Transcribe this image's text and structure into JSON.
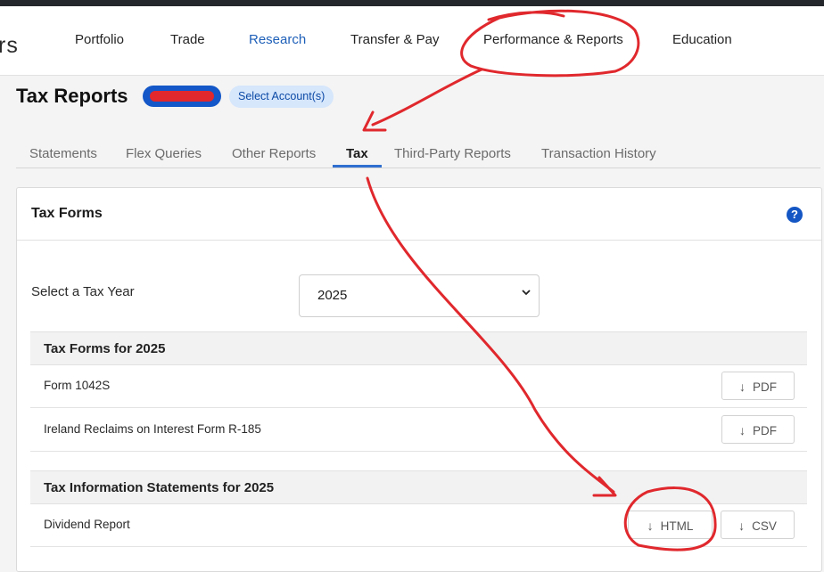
{
  "nav": {
    "brand_fragment": "rs",
    "items": [
      "Portfolio",
      "Trade",
      "Research",
      "Transfer & Pay",
      "Performance & Reports",
      "Education"
    ],
    "active": "Research"
  },
  "header": {
    "title": "Tax Reports",
    "select_account_label": "Select Account(s)"
  },
  "tabs": {
    "items": [
      "Statements",
      "Flex Queries",
      "Other Reports",
      "Tax",
      "Third-Party Reports",
      "Transaction History"
    ],
    "active": "Tax"
  },
  "card": {
    "title": "Tax Forms",
    "help_icon": "?",
    "year_label": "Select a Tax Year",
    "year_value": "2025",
    "year_chevron": "⌄"
  },
  "sections": [
    {
      "title": "Tax Forms for 2025",
      "rows": [
        {
          "label": "Form 1042S",
          "buttons": [
            "PDF"
          ]
        },
        {
          "label": "Ireland Reclaims on Interest Form R-185",
          "buttons": [
            "PDF"
          ]
        }
      ]
    },
    {
      "title": "Tax Information Statements for 2025",
      "rows": [
        {
          "label": "Dividend Report",
          "buttons": [
            "HTML",
            "CSV"
          ]
        }
      ]
    }
  ],
  "icons": {
    "download": "↓",
    "help": "question-circle-icon"
  },
  "colors": {
    "accent": "#1d5fb8",
    "annotation": "#e0282d",
    "pill": "#1357c8",
    "help": "#1456c4"
  }
}
